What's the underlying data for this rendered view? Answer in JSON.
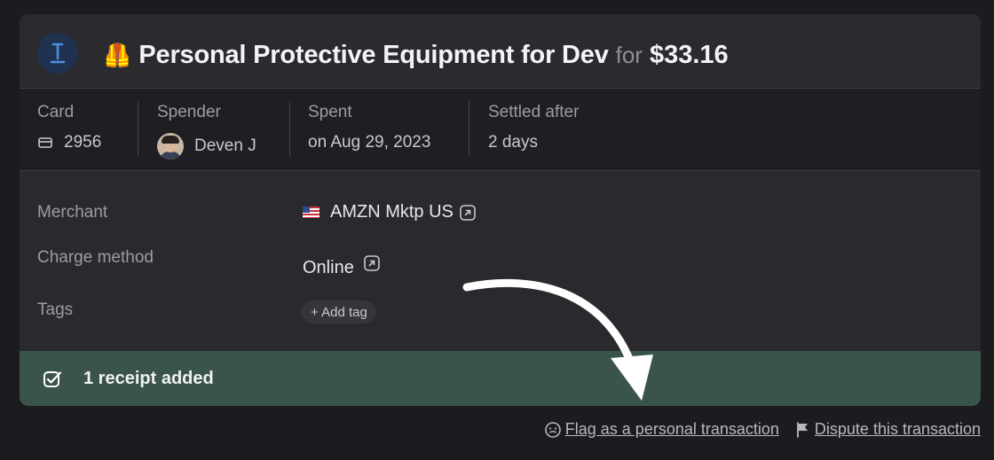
{
  "transaction": {
    "vest_emoji": "🦺",
    "title": "Personal Protective Equipment for Dev",
    "for_word": "for",
    "amount": "$33.16"
  },
  "meta": {
    "card": {
      "label": "Card",
      "value": "2956"
    },
    "spender": {
      "label": "Spender",
      "value": "Deven J"
    },
    "spent": {
      "label": "Spent",
      "value": "on Aug 29, 2023"
    },
    "settled": {
      "label": "Settled after",
      "value": "2 days"
    }
  },
  "details": {
    "merchant": {
      "label": "Merchant",
      "value": "AMZN Mktp US"
    },
    "charge_method": {
      "label": "Charge method",
      "value": "Online"
    },
    "tags": {
      "label": "Tags",
      "add_label": "+ Add tag"
    }
  },
  "receipt": {
    "text": "1 receipt added"
  },
  "footer": {
    "flag_label": "Flag as a personal transaction",
    "dispute_label": "Dispute this transaction"
  },
  "colors": {
    "receipt_banner": "#3a5449",
    "logo_bg": "#1f3350",
    "logo_accent": "#4f8fe0"
  }
}
